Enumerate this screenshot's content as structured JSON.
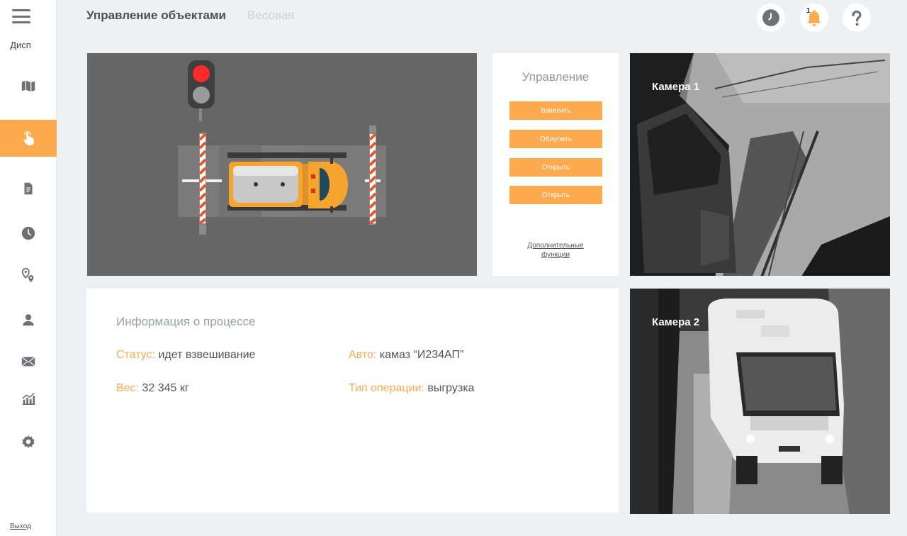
{
  "sidebar": {
    "brand": "Дисп",
    "logout": "Выход",
    "items": [
      {
        "name": "map",
        "icon": "map-icon"
      },
      {
        "name": "control",
        "icon": "touch-icon",
        "active": true
      },
      {
        "name": "documents",
        "icon": "document-icon"
      },
      {
        "name": "history",
        "icon": "clock-icon"
      },
      {
        "name": "locations",
        "icon": "location-pin-icon"
      },
      {
        "name": "users",
        "icon": "user-icon"
      },
      {
        "name": "messages",
        "icon": "mail-icon"
      },
      {
        "name": "analytics",
        "icon": "chart-icon"
      },
      {
        "name": "settings",
        "icon": "gear-icon"
      }
    ]
  },
  "header": {
    "title": "Управление объектами",
    "subtitle": "Весовая",
    "notification_count": "1",
    "buttons": [
      "clock-icon",
      "bell-icon",
      "help-icon"
    ]
  },
  "control": {
    "title": "Управление",
    "buttons": [
      "Взвесить",
      "Обнулить",
      "Открыть",
      "Открыть"
    ],
    "extra_link_line1": "Дополнительные",
    "extra_link_line2": "функции"
  },
  "cameras": [
    {
      "label": "Камера 1"
    },
    {
      "label": "Камера 2"
    }
  ],
  "info": {
    "title": "Информация о процессе",
    "status_key": "Статус:",
    "status_val": "идет взвешивание",
    "auto_key": "Авто:",
    "auto_val": "камаз “И234АП”",
    "weight_key": "Вес:",
    "weight_val": "32 345 кг",
    "optype_key": "Тип операции:",
    "optype_val": "выгрузка"
  },
  "colors": {
    "accent": "#fdaa4e",
    "scheme_bg": "#666666",
    "traffic_red": "#ff2a2a"
  }
}
